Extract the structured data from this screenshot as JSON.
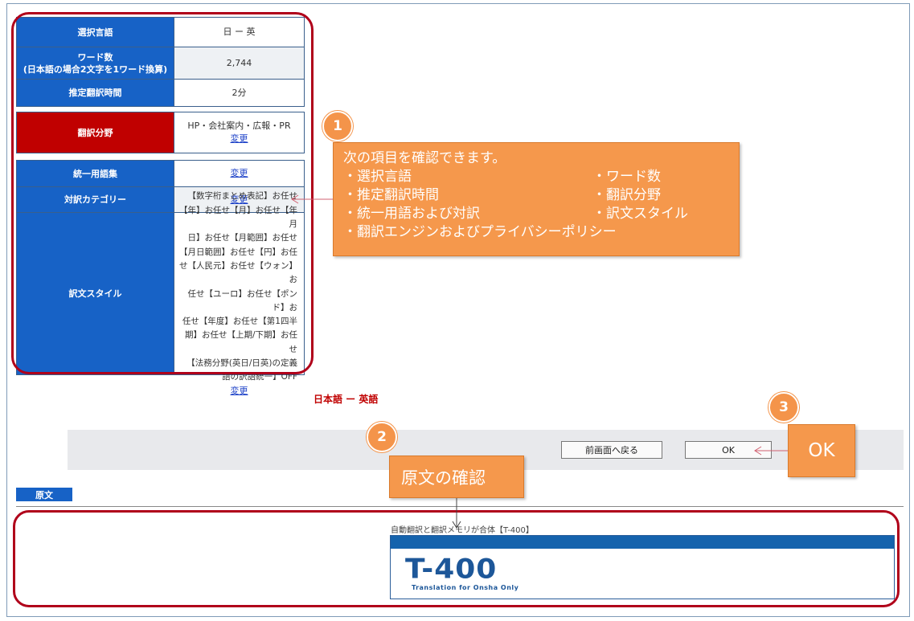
{
  "settings": {
    "rows": [
      {
        "label": "選択言語",
        "value": "日 ー 英"
      },
      {
        "label": "ワード数\n(日本語の場合2文字を1ワード換算)",
        "label1": "ワード数",
        "label2": "(日本語の場合2文字を1ワード換算)",
        "value": "2,744"
      },
      {
        "label": "推定翻訳時間",
        "value": "2分"
      }
    ],
    "field": {
      "label": "翻訳分野",
      "value": "HP・会社案内・広報・PR",
      "change": "変更"
    },
    "glossary": {
      "label": "統一用語集",
      "change": "変更"
    },
    "category": {
      "label": "対訳カテゴリー",
      "change": "変更"
    },
    "style": {
      "label": "訳文スタイル",
      "lines": [
        "【数字桁まとめ表記】お任せ",
        "【年】お任せ【月】お任せ【年月",
        "日】お任せ【月範囲】お任せ",
        "【月日範囲】お任せ【円】お任",
        "せ【人民元】お任せ【ウォン】お",
        "任せ【ユーロ】お任せ【ポンド】お",
        "任せ【年度】お任せ【第1四半",
        "期】お任せ【上期/下期】お任せ",
        "【法務分野(英日/日英)の定義",
        "語の訳語統一】OFF"
      ],
      "change": "変更"
    }
  },
  "callout1": {
    "badge": "1",
    "title": "次の項目を確認できます。",
    "items": [
      "・選択言語",
      "・ワード数",
      "・推定翻訳時間",
      "・翻訳分野",
      "・統一用語および対訳",
      "・訳文スタイル"
    ],
    "last": "・翻訳エンジンおよびプライバシーポリシー"
  },
  "callout2": {
    "badge": "2",
    "text": "原文の確認"
  },
  "callout3": {
    "badge": "3",
    "text": "OK"
  },
  "language_pair": "日本語 ー 英語",
  "buttons": {
    "back": "前画面へ戻る",
    "ok": "OK"
  },
  "source": {
    "tab": "原文",
    "text": "自動翻訳と翻訳メモリが合体【T-400】",
    "logo": "T-400",
    "logo_sub": "Translation for Onsha Only"
  },
  "colors": {
    "header_blue": "#1762c6",
    "header_red": "#c00000",
    "callout_orange": "#f5984c",
    "outline_red": "#b0001a"
  }
}
